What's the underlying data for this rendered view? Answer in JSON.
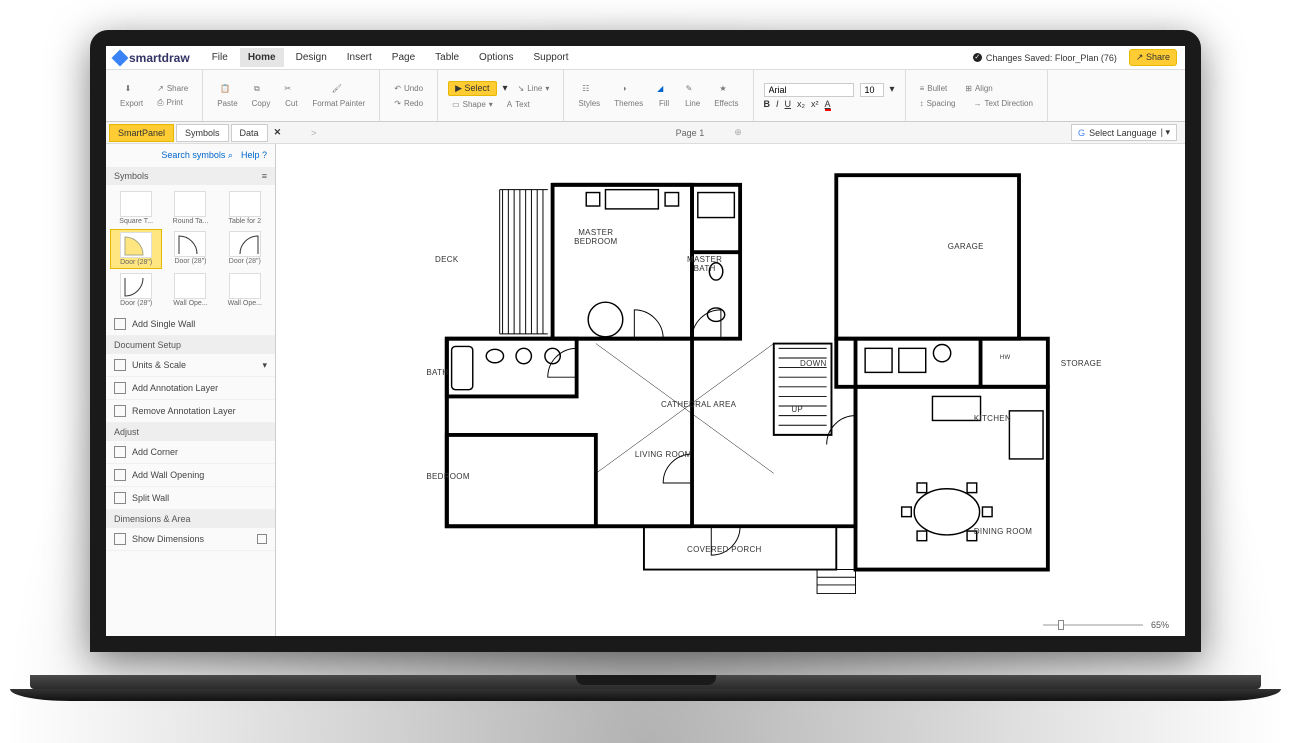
{
  "app": {
    "name": "smartdraw"
  },
  "menubar": {
    "items": [
      "File",
      "Home",
      "Design",
      "Insert",
      "Page",
      "Table",
      "Options",
      "Support"
    ],
    "active": 1,
    "saved_label": "Changes Saved: Floor_Plan (76)",
    "share": "Share"
  },
  "ribbon": {
    "export": "Export",
    "share": "Share",
    "print": "Print",
    "paste": "Paste",
    "copy": "Copy",
    "cut": "Cut",
    "format_painter": "Format Painter",
    "undo": "Undo",
    "redo": "Redo",
    "select": "Select",
    "line": "Line",
    "shape": "Shape",
    "text": "Text",
    "styles": "Styles",
    "themes": "Themes",
    "fill": "Fill",
    "line2": "Line",
    "effects": "Effects",
    "font_name": "Arial",
    "font_size": "10",
    "bold": "B",
    "italic": "I",
    "underline": "U",
    "bullet": "Bullet",
    "align": "Align",
    "spacing": "Spacing",
    "textdir": "Text Direction"
  },
  "tabs": {
    "smartpanel": "SmartPanel",
    "symbols": "Symbols",
    "data": "Data",
    "page_label": "Page 1",
    "lang": "Select Language"
  },
  "sidebar": {
    "search": "Search symbols",
    "help": "Help",
    "symbols_head": "Symbols",
    "syms": [
      {
        "label": "Square T..."
      },
      {
        "label": "Round Ta..."
      },
      {
        "label": "Table for 2"
      },
      {
        "label": "Door (28\")"
      },
      {
        "label": "Door (28\")"
      },
      {
        "label": "Door (28\")"
      },
      {
        "label": "Door (28\")"
      },
      {
        "label": "Wall Ope..."
      },
      {
        "label": "Wall Ope..."
      }
    ],
    "add_wall": "Add Single Wall",
    "docsetup": "Document Setup",
    "units": "Units & Scale",
    "add_anno": "Add Annotation Layer",
    "rem_anno": "Remove Annotation Layer",
    "adjust": "Adjust",
    "add_corner": "Add Corner",
    "add_open": "Add Wall Opening",
    "split": "Split Wall",
    "dims_head": "Dimensions & Area",
    "show_dims": "Show Dimensions"
  },
  "plan": {
    "deck": "DECK",
    "master_bed": "MASTER\nBEDROOM",
    "master_bath": "MASTER\nBATH",
    "garage": "GARAGE",
    "bath": "BATH",
    "down": "DOWN",
    "storage": "STORAGE",
    "hw": "HW",
    "cathedral": "CATHEDRAL AREA",
    "up": "UP",
    "kitchen": "KITCHEN",
    "bedroom": "BEDROOM",
    "living": "LIVING ROOM",
    "dining": "DINING ROOM",
    "porch": "COVERED PORCH"
  },
  "zoom": {
    "value": "65%"
  }
}
